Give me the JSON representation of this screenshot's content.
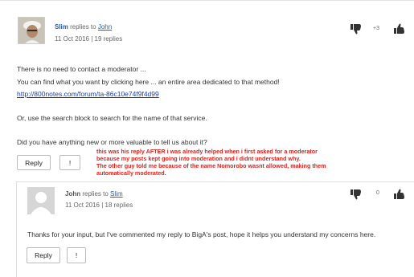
{
  "post1": {
    "username": "Slim",
    "replies_to_label": "replies to",
    "replies_to_user": "John",
    "date_line": "11 Oct 2016 | 19 replies",
    "score": "+3",
    "lines": [
      "There is no need to contact a moderator ...",
      "You can find what you want by clicking here ... an entire area dedicated to that method!",
      "http://800notes.com/forum/ta-86c10e74f9f4d99",
      "Or, use the search block to search for the name of that service.",
      "Did you have anything new or more valuable to tell us about it?"
    ],
    "reply_label": "Reply",
    "flag_label": "!"
  },
  "annotation": [
    "this was his reply AFTER i was already helped when i first asked for a moderator",
    "because my posts kept going into moderation and i didnt understand why.",
    "The other guy told me because of the name Nomorobo wasnt allowed, making them",
    " automatically moderated."
  ],
  "post2": {
    "username": "John",
    "replies_to_label": "replies to",
    "replies_to_user": "Slim",
    "date_line": "11 Oct 2016 | 18 replies",
    "score": "0",
    "text": "Thanks for your input, but I've commented  my reply to BigA's post, hope it helps you understand my concerns here.",
    "reply_label": "Reply",
    "flag_label": "!"
  },
  "colors": {
    "link": "#1a3fa0",
    "annotation": "#e0201b"
  },
  "icons": [
    "thumbs-down-icon",
    "thumbs-up-icon",
    "avatar-photo",
    "avatar-placeholder-icon"
  ]
}
